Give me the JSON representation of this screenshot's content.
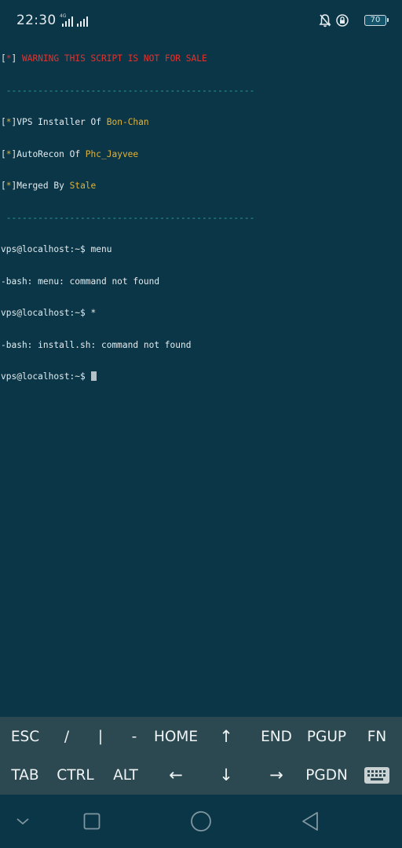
{
  "status_bar": {
    "time": "22:30",
    "network_label": "4G",
    "battery": "70"
  },
  "terminal": {
    "banner_warning_prefix": "[",
    "banner_warning_star": "*",
    "banner_warning_suffix": "] ",
    "banner_warning_text": "WARNING THIS SCRIPT IS NOT FOR SALE",
    "separator": " -----------------------------------------------",
    "credits": [
      {
        "prefix": "[",
        "star": "*",
        "label": "]VPS Installer Of ",
        "name": "Bon-Chan"
      },
      {
        "prefix": "[",
        "star": "*",
        "label": "]AutoRecon Of ",
        "name": "Phc_Jayvee"
      },
      {
        "prefix": "[",
        "star": "*",
        "label": "]Merged By ",
        "name": "Stale"
      }
    ],
    "lines": [
      "vps@localhost:~$ menu",
      "-bash: menu: command not found",
      "vps@localhost:~$ *",
      "-bash: install.sh: command not found"
    ],
    "prompt": "vps@localhost:~$ "
  },
  "extra_keys": {
    "row1": [
      "ESC",
      "/",
      "|",
      "-",
      "HOME",
      "↑",
      "END",
      "PGUP",
      "FN"
    ],
    "row2": [
      "TAB",
      "CTRL",
      "ALT",
      "←",
      "↓",
      "→",
      "PGDN"
    ]
  },
  "colors": {
    "background": "#0b3647",
    "extra_keys_bg": "#2c4951",
    "warning": "#e5322d",
    "highlight": "#dfb33c",
    "separator": "#2a9ea3"
  }
}
